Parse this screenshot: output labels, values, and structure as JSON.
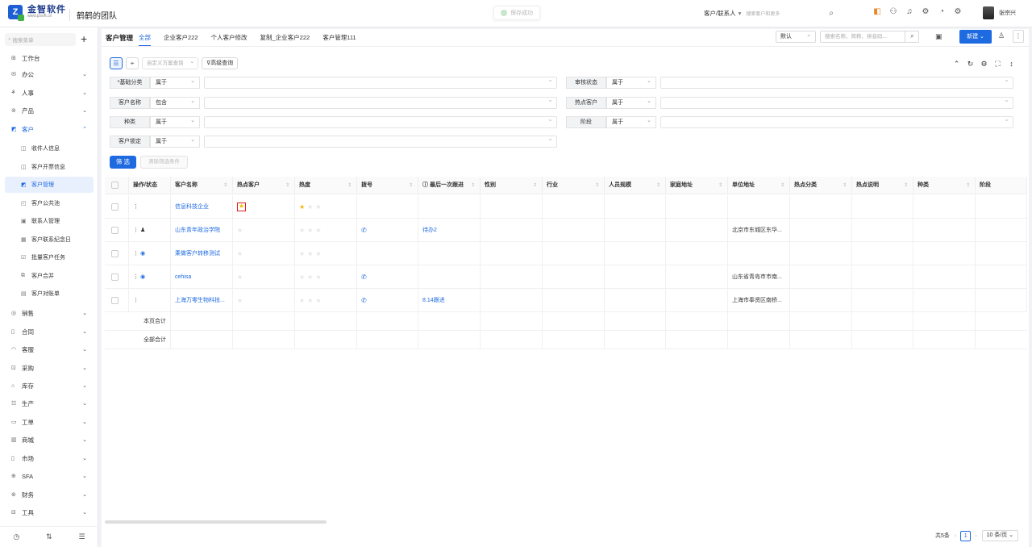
{
  "header": {
    "logo_name": "金智软件",
    "logo_url_text": "www.jzsoft.cn",
    "team": "鹤鹤的团队",
    "toast": "保存成功",
    "search_scope": "客户/联系人",
    "search_placeholder": "搜索客户和更多",
    "user_name": "张宗兴"
  },
  "sidebar": {
    "search_placeholder": "搜索菜单",
    "items": [
      {
        "label": "工作台",
        "icon": "grid-icon"
      },
      {
        "label": "办公",
        "icon": "mail-icon"
      },
      {
        "label": "人事",
        "icon": "people-icon"
      },
      {
        "label": "产品",
        "icon": "box-icon"
      },
      {
        "label": "客户",
        "icon": "customer-icon"
      }
    ],
    "sub_items": [
      "收件人信息",
      "客户开票信息",
      "客户管理",
      "客户公共池",
      "联系人管理",
      "客户联系纪念日",
      "批量客户任务",
      "客户合并",
      "客户对账单"
    ],
    "items2": [
      "销售",
      "合同",
      "客服",
      "采购",
      "库存",
      "生产",
      "工单",
      "商城",
      "市场",
      "SFA",
      "财务",
      "工具"
    ]
  },
  "main": {
    "title": "客户管理",
    "tabs": [
      "全部",
      "企业客户222",
      "个人客户修改",
      "复制_企业客户222",
      "客户管理111"
    ],
    "view_select": "默认",
    "search_placeholder": "搜索名称、简称、拼音码...",
    "new_label": "新建",
    "scheme_placeholder": "自定义方案查询",
    "advanced_label": "高级查询",
    "filters": [
      {
        "label": "*基础分类",
        "op": "属于"
      },
      {
        "label": "审核状态",
        "op": "属于"
      },
      {
        "label": "客户名称",
        "op": "包含"
      },
      {
        "label": "热点客户",
        "op": "属于"
      },
      {
        "label": "种类",
        "op": "属于"
      },
      {
        "label": "阶段",
        "op": "属于"
      },
      {
        "label": "客户锁定",
        "op": "属于"
      }
    ],
    "filter_btn": "筛 选",
    "clear_btn": "清除筛选条件"
  },
  "table": {
    "headers": [
      "操作/状态",
      "客户名称",
      "热点客户",
      "热度",
      "拨号",
      "最后一次跟进",
      "性别",
      "行业",
      "人员规模",
      "家庭地址",
      "单位地址",
      "热点分类",
      "热点说明",
      "种类",
      "阶段"
    ],
    "rows": [
      {
        "name": "信息科技企业",
        "heat": 1,
        "hot_marked": true,
        "phone": false,
        "follow": "",
        "address": ""
      },
      {
        "name": "山东青年政治学院",
        "heat": 0,
        "hot_marked": false,
        "phone": true,
        "follow": "待办2",
        "address": "北京市东城区东华..."
      },
      {
        "name": "乘做客户转移测试",
        "heat": 0,
        "hot_marked": false,
        "phone": false,
        "follow": "",
        "address": ""
      },
      {
        "name": "cehisa",
        "heat": 0,
        "hot_marked": false,
        "phone": true,
        "follow": "",
        "address": "山东省青岛市市南..."
      },
      {
        "name": "上海万零生物科技...",
        "heat": 0,
        "hot_marked": false,
        "phone": true,
        "follow": "8.14跟进",
        "address": "上海市奉贤区南桥..."
      }
    ],
    "page_total": "本页合计",
    "all_total": "全部合计"
  },
  "pager": {
    "total": "共5条",
    "page": "1",
    "size": "10 条/页"
  },
  "colors": {
    "accent": "#1e6ae0",
    "star": "#f5b800",
    "highlight": "#e02020"
  }
}
